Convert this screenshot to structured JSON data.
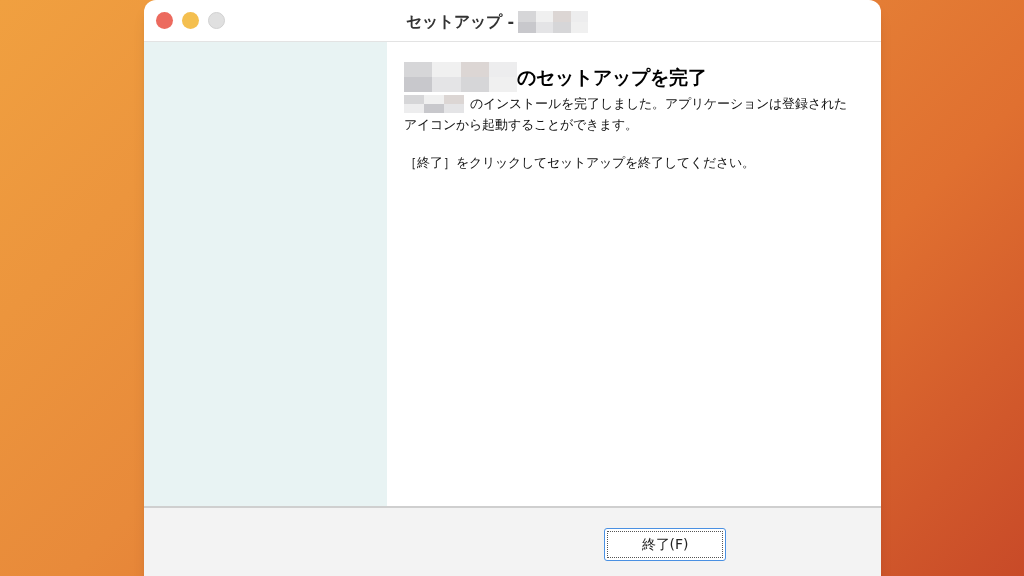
{
  "window": {
    "title": "セットアップ -"
  },
  "content": {
    "heading": "のセットアップを完了",
    "message_lines": [
      "のインストールを完了しました。アプリケーションは登録された",
      "アイコンから起動することができます。"
    ],
    "instruction": "［終了］をクリックしてセットアップを終了してください。"
  },
  "buttons": [
    {
      "label": "終了(F)",
      "focused": true
    }
  ]
}
